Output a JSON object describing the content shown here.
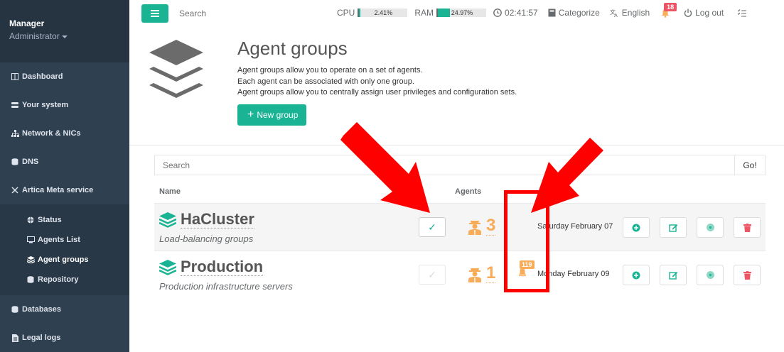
{
  "sidebar": {
    "user_name": "Manager",
    "user_role": "Administrator",
    "items": [
      {
        "label": "Dashboard",
        "icon": "columns-icon"
      },
      {
        "label": "Your system",
        "icon": "server-icon"
      },
      {
        "label": "Network & NICs",
        "icon": "sitemap-icon"
      },
      {
        "label": "DNS",
        "icon": "database-icon"
      },
      {
        "label": "Artica Meta service",
        "icon": "nodes-icon"
      }
    ],
    "sub_items": [
      {
        "label": "Status",
        "icon": "globe-icon"
      },
      {
        "label": "Agents List",
        "icon": "desktop-icon"
      },
      {
        "label": "Agent groups",
        "icon": "layers-icon"
      },
      {
        "label": "Repository",
        "icon": "database-icon"
      }
    ],
    "bottom_items": [
      {
        "label": "Databases",
        "icon": "database-icon"
      },
      {
        "label": "Legal logs",
        "icon": "file-icon"
      }
    ]
  },
  "topbar": {
    "search_placeholder": "Search",
    "cpu_label": "CPU",
    "cpu_value": "2.41%",
    "cpu_fraction": 0.0241,
    "ram_label": "RAM",
    "ram_value": "24.97%",
    "ram_fraction": 0.2497,
    "clock": "02:41:57",
    "categorize": "Categorize",
    "language": "English",
    "notifications": "18",
    "logout": "Log out"
  },
  "header": {
    "title": "Agent groups",
    "desc1": "Agent groups allow you to operate on a set of agents.",
    "desc2": "Each agent can be associated with only one group.",
    "desc3": "Agent groups allow you to centrally assign user privileges and configuration sets.",
    "new_group": "New group"
  },
  "table": {
    "search_placeholder": "Search",
    "go": "Go!",
    "col_name": "Name",
    "col_agents": "Agents",
    "rows": [
      {
        "name": "HaCluster",
        "desc": "Load-balancing groups",
        "agents": "3",
        "date": "Saturday February 07",
        "checked": true,
        "alerts": ""
      },
      {
        "name": "Production",
        "desc": "Production infrastructure servers",
        "agents": "1",
        "date": "Monday February 09",
        "checked": false,
        "alerts": "119"
      }
    ]
  },
  "colors": {
    "primary": "#1ab394",
    "sidebar": "#2f4050",
    "warning": "#f8ac59",
    "danger": "#ed5565",
    "annotation": "#ff0000"
  }
}
